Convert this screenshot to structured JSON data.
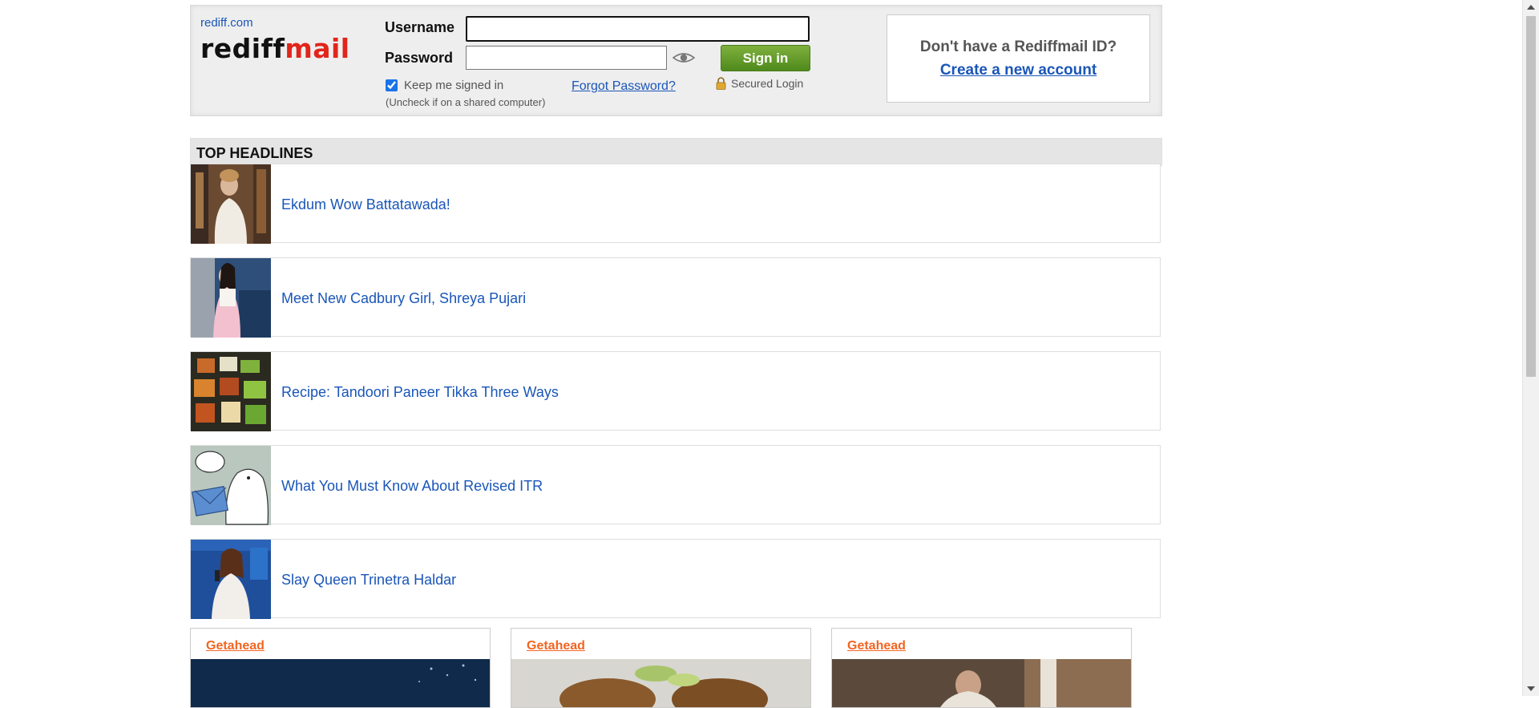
{
  "header": {
    "site_link": "rediff.com",
    "logo_part1": "rediff",
    "logo_part2": "mail",
    "username_label": "Username",
    "password_label": "Password",
    "username_value": "",
    "password_value": "",
    "signin_label": "Sign in",
    "keep_signed_in_label": "Keep me signed in",
    "keep_signed_in_checked": true,
    "uncheck_note": "(Uncheck if on a shared computer)",
    "forgot_password": "Forgot Password?",
    "secured_login": "Secured Login",
    "no_account_question": "Don't have a Rediffmail ID?",
    "create_account": "Create a new account"
  },
  "headlines": {
    "title": "TOP HEADLINES",
    "items": [
      {
        "text": "Ekdum Wow Battatawada!"
      },
      {
        "text": "Meet New Cadbury Girl, Shreya Pujari"
      },
      {
        "text": "Recipe: Tandoori Paneer Tikka Three Ways"
      },
      {
        "text": "What You Must Know About Revised ITR"
      },
      {
        "text": "Slay Queen Trinetra Haldar"
      }
    ]
  },
  "cards": [
    {
      "label": "Getahead"
    },
    {
      "label": "Getahead"
    },
    {
      "label": "Getahead"
    }
  ],
  "colors": {
    "link": "#1a56b8",
    "logo_accent": "#e1251b",
    "signin_green": "#5d9a26",
    "getahead_orange": "#f26522"
  }
}
